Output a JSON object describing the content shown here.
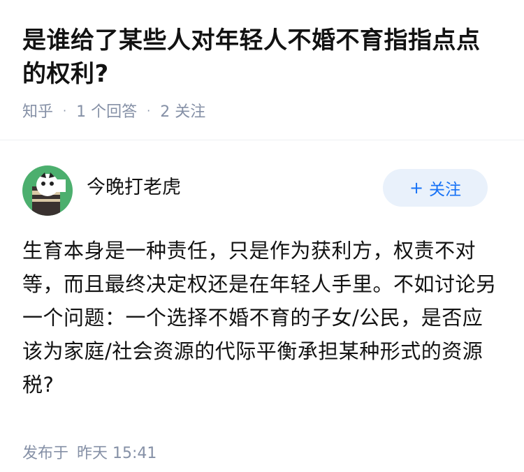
{
  "question": {
    "title": "是谁给了某些人对年轻人不婚不育指指点点的权利?",
    "source": "知乎",
    "answers_count": "1 个回答",
    "followers_count": "2 关注"
  },
  "answer": {
    "author": "今晚打老虎",
    "follow_plus": "+",
    "follow_label": "关注",
    "content": "生育本身是一种责任，只是作为获利方，权责不对等，而且最终决定权还是在年轻人手里。不如讨论另一个问题：一个选择不婚不育的子女/公民，是否应该为家庭/社会资源的代际平衡承担某种形式的资源税?",
    "published_label": "发布于",
    "published_time": "昨天 15:41"
  },
  "colors": {
    "accent": "#1772f6",
    "follow_bg": "#e9f1fb",
    "meta": "#8590a6",
    "avatar_bg": "#4caf6e"
  }
}
